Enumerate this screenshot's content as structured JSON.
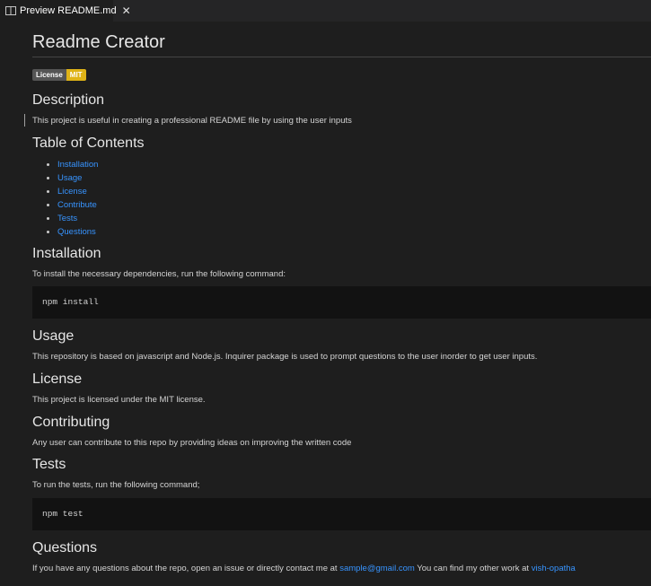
{
  "tab": {
    "label": "Preview README.md",
    "icon": "preview-icon",
    "close": "✕"
  },
  "doc": {
    "title": "Readme Creator",
    "badge": {
      "left": "License",
      "right": "MIT",
      "right_color": "#dfb317"
    },
    "description": {
      "heading": "Description",
      "text": "This project is useful in creating a professional README file by using the user inputs"
    },
    "toc": {
      "heading": "Table of Contents",
      "items": [
        "Installation",
        "Usage",
        "License",
        "Contribute",
        "Tests",
        "Questions"
      ]
    },
    "installation": {
      "heading": "Installation",
      "text": "To install the necessary dependencies, run the following command:",
      "code": "npm install"
    },
    "usage": {
      "heading": "Usage",
      "text": "This repository is based on javascript and Node.js. Inquirer package is used to prompt questions to the user inorder to get user inputs."
    },
    "license": {
      "heading": "License",
      "text": "This project is licensed under the MIT license."
    },
    "contributing": {
      "heading": "Contributing",
      "text": "Any user can contribute to this repo by providing ideas on improving the written code"
    },
    "tests": {
      "heading": "Tests",
      "text": "To run the tests, run the following command;",
      "code": "npm test"
    },
    "questions": {
      "heading": "Questions",
      "text_before": "If you have any questions about the repo, open an issue or directly contact me at",
      "email": "sample@gmail.com",
      "text_middle": "You can find my other work at",
      "profile": "vish-opatha"
    }
  },
  "colors": {
    "background": "#1e1e1e",
    "link": "#3794ff",
    "code_background": "#121212"
  }
}
